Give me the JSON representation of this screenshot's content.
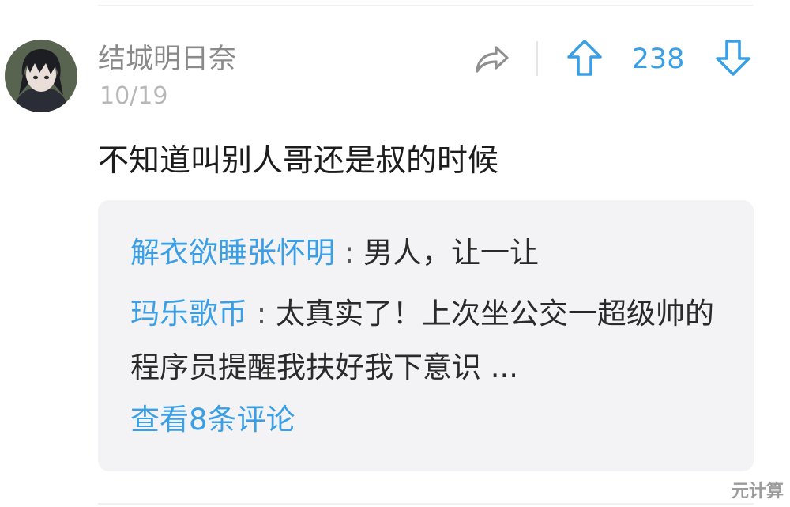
{
  "post": {
    "username": "结城明日奈",
    "date": "10/19",
    "vote_count": "238",
    "content": "不知道叫别人哥还是叔的时候"
  },
  "replies": [
    {
      "author": "解衣欲睡张怀明",
      "separator": " : ",
      "text": "男人，让一让"
    },
    {
      "author": "玛乐歌币",
      "separator": " : ",
      "text": "太真实了！上次坐公交一超级帅的程序员提醒我扶好我下意识 ..."
    }
  ],
  "view_more": "查看8条评论",
  "watermark": "元计算",
  "colors": {
    "accent": "#3b9fe6",
    "muted": "#8a8a8a",
    "date": "#b7b7b7",
    "reply_bg": "#f3f3f5"
  },
  "icons": {
    "share": "share-arrow-icon",
    "upvote": "arrow-up-icon",
    "downvote": "arrow-down-icon"
  }
}
